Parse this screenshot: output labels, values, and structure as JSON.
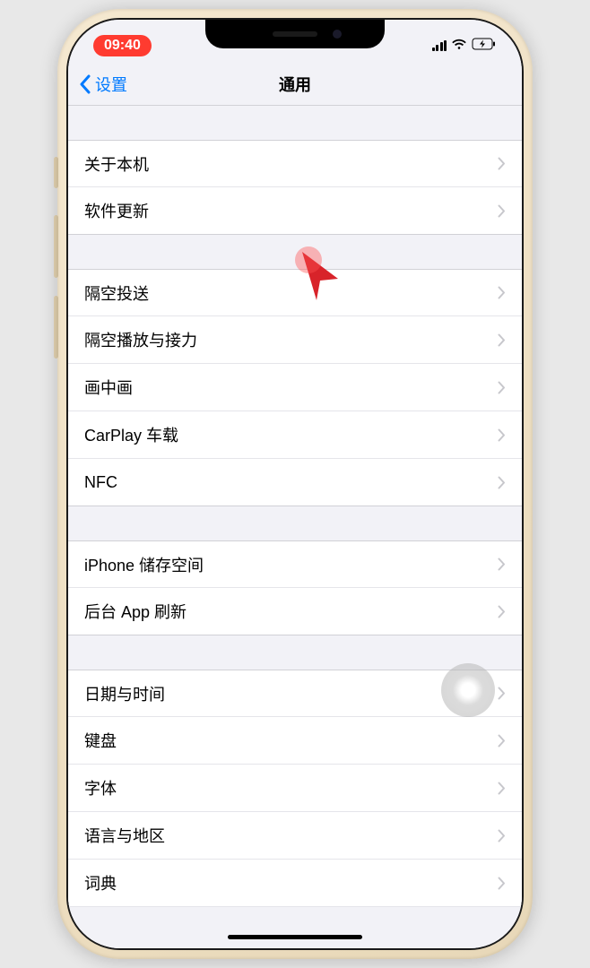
{
  "status": {
    "time": "09:40"
  },
  "nav": {
    "back": "设置",
    "title": "通用"
  },
  "sections": [
    {
      "items": [
        {
          "label": "关于本机"
        },
        {
          "label": "软件更新"
        }
      ]
    },
    {
      "items": [
        {
          "label": "隔空投送"
        },
        {
          "label": "隔空播放与接力"
        },
        {
          "label": "画中画"
        },
        {
          "label": "CarPlay 车载"
        },
        {
          "label": "NFC"
        }
      ]
    },
    {
      "items": [
        {
          "label": "iPhone 储存空间"
        },
        {
          "label": "后台 App 刷新"
        }
      ]
    },
    {
      "items": [
        {
          "label": "日期与时间"
        },
        {
          "label": "键盘"
        },
        {
          "label": "字体"
        },
        {
          "label": "语言与地区"
        },
        {
          "label": "词典"
        }
      ]
    }
  ]
}
